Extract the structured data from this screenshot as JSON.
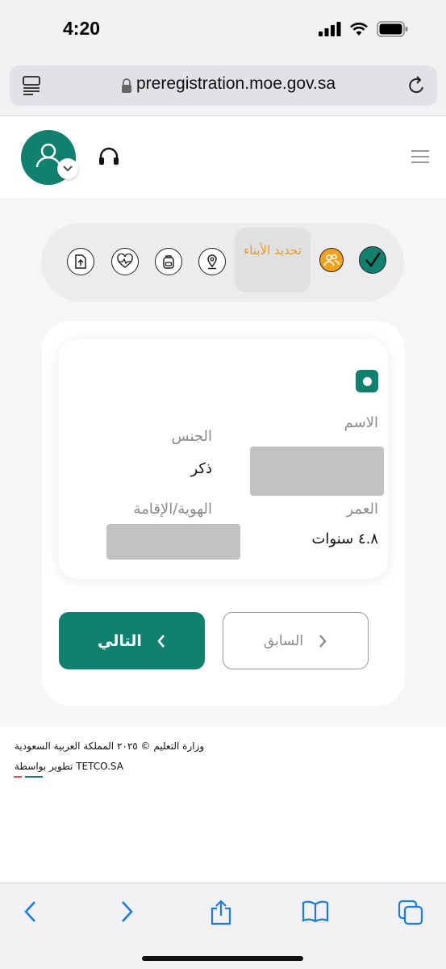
{
  "status": {
    "time": "4:20"
  },
  "browser": {
    "url": "preregistration.moe.gov.sa"
  },
  "stepper": {
    "active_step_label": "تحديد الأبناء"
  },
  "child": {
    "name_label": "الاسم",
    "gender_label": "الجنس",
    "gender_value": "ذكر",
    "age_label": "العمر",
    "age_value": "٤.٨ سنوات",
    "id_label": "الهوية/الإقامة"
  },
  "buttons": {
    "next_label": "التالي",
    "prev_label": "السابق"
  },
  "footer": {
    "copyright": "وزارة التعليم © ٢٠٢٥ المملكة العربية السعودية",
    "developer": "تطوير بواسطة TETCO.SA"
  },
  "colors": {
    "brand_teal": "#12806f",
    "step_orange": "#f2a21a",
    "ios_blue": "#1a7ee0"
  },
  "icons": {
    "status": [
      "signal-icon",
      "wifi-icon",
      "battery-icon"
    ],
    "steps": [
      "upload-icon",
      "health-icon",
      "backpack-icon",
      "location-icon",
      "users-icon",
      "check-icon"
    ],
    "toolbar": [
      "back-icon",
      "forward-icon",
      "share-icon",
      "bookmarks-icon",
      "tabs-icon"
    ]
  }
}
